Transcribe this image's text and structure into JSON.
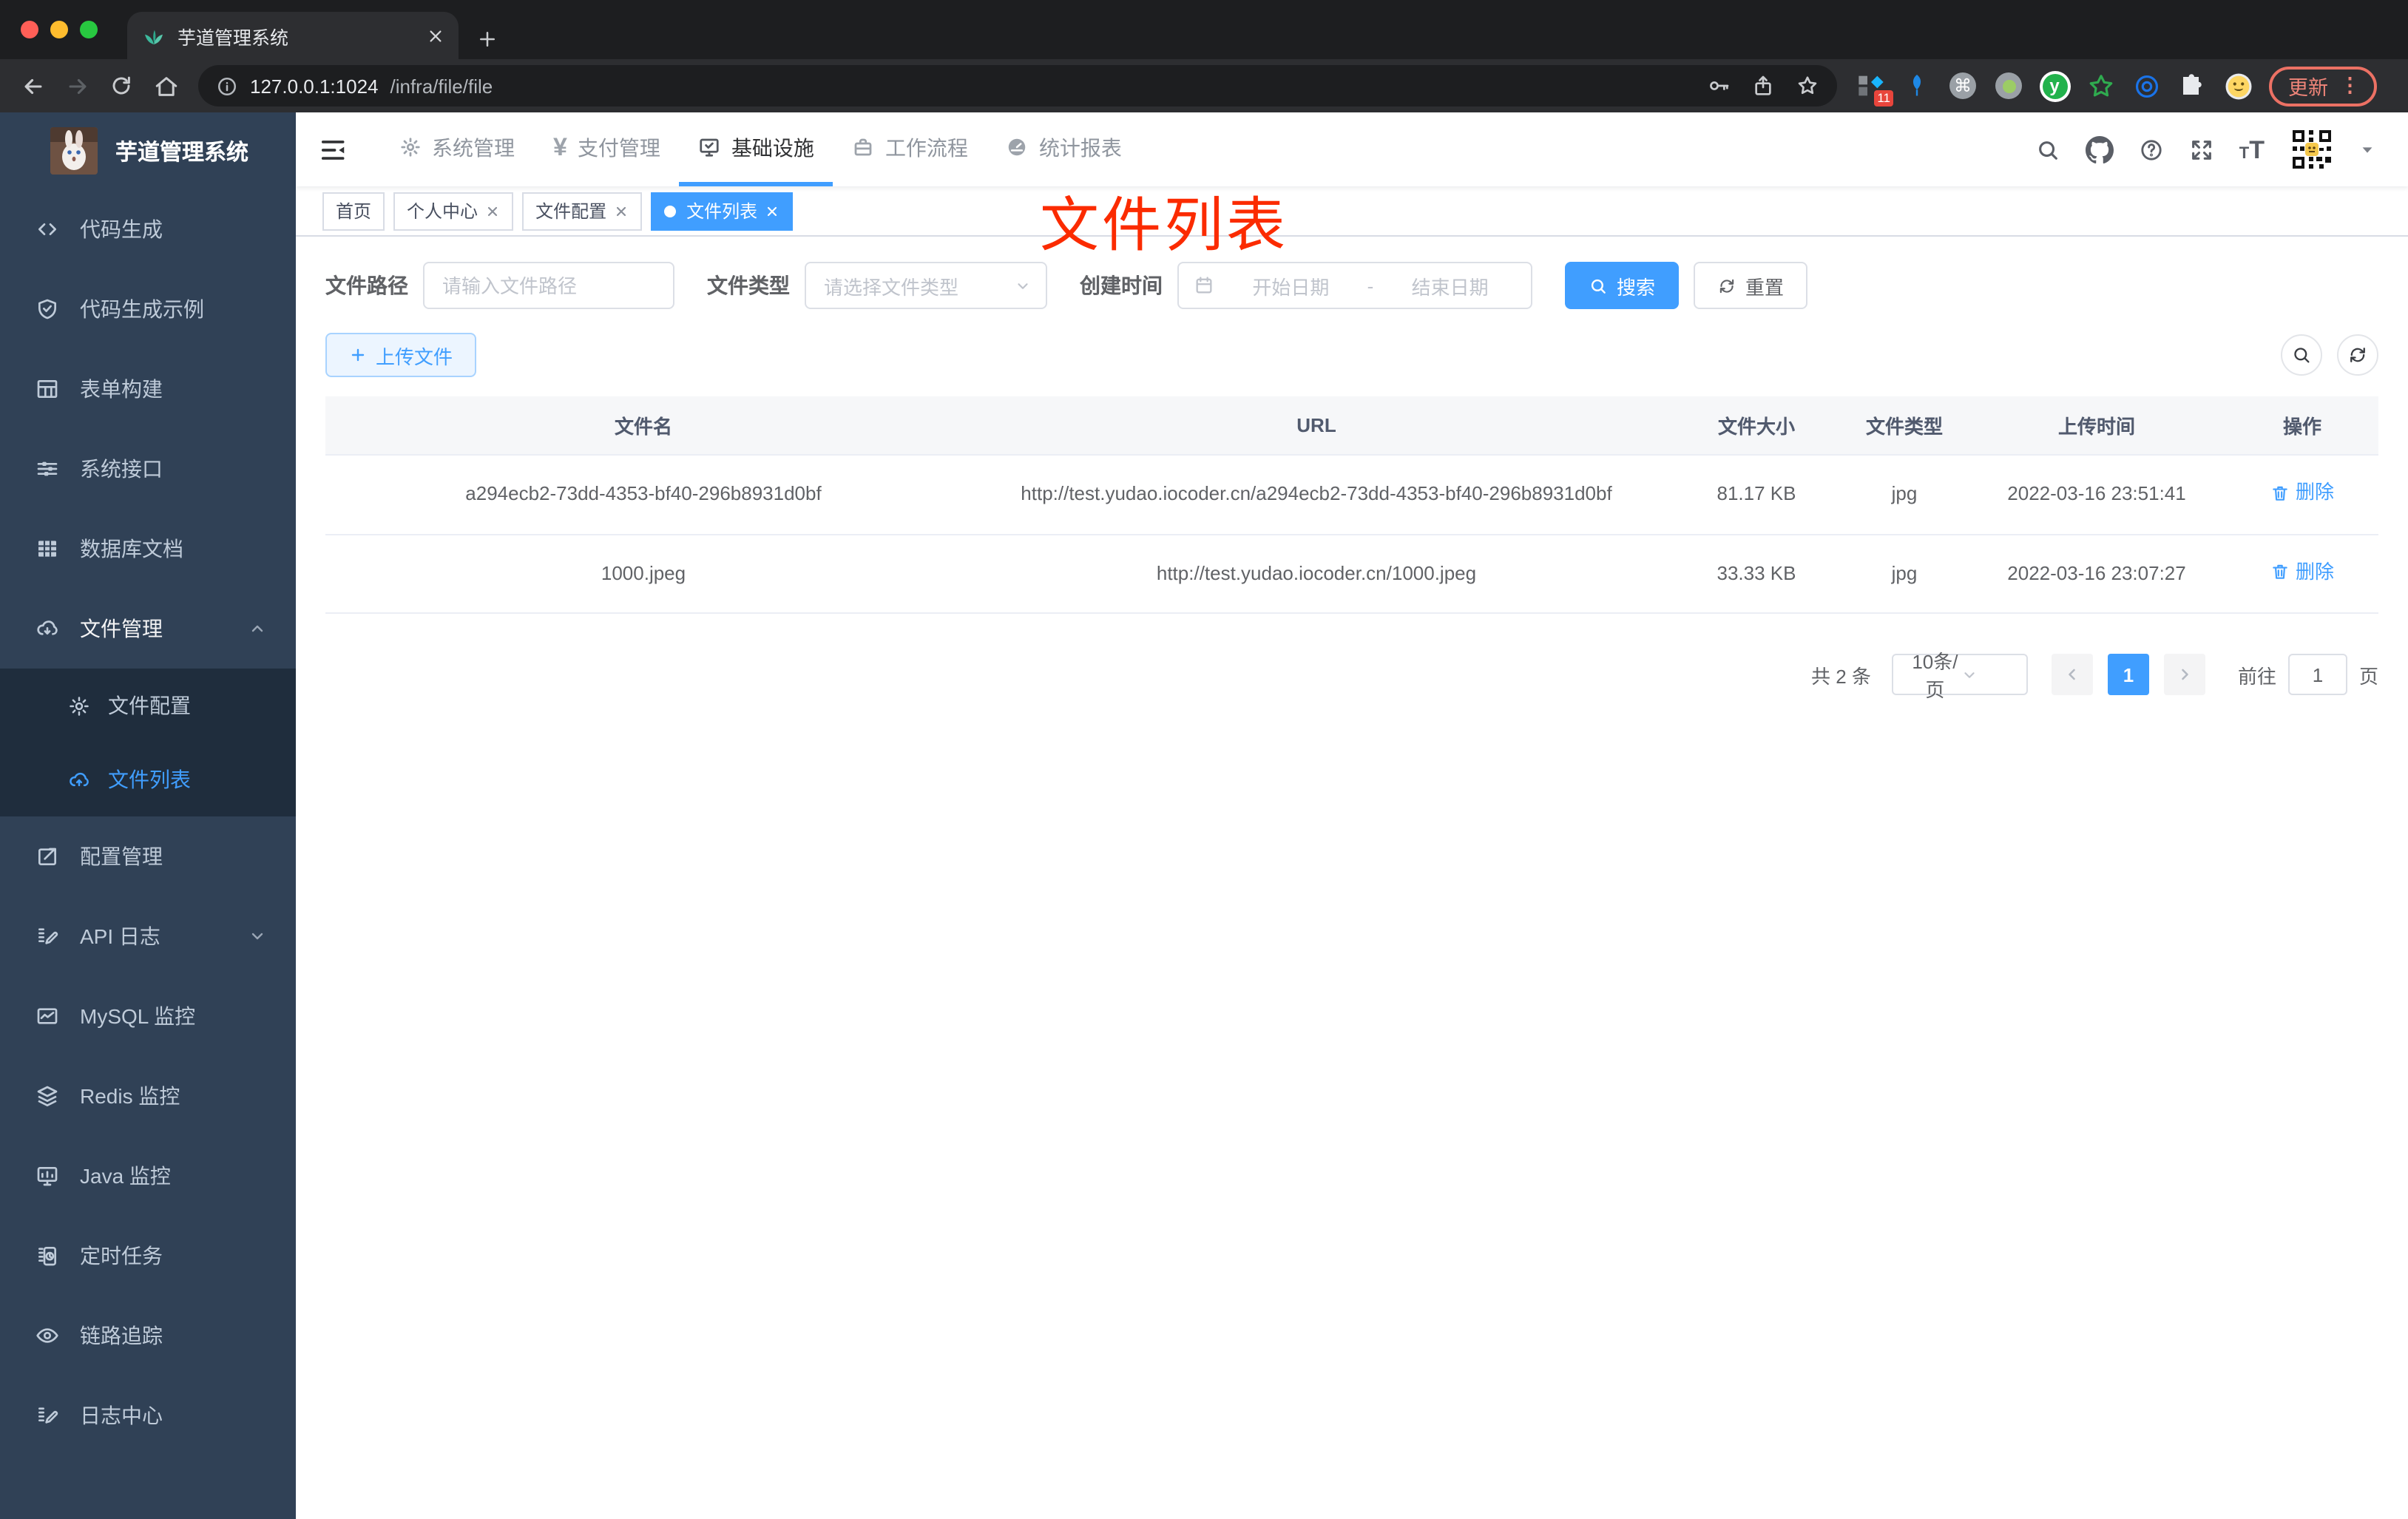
{
  "browser": {
    "tab_title": "芋道管理系统",
    "url_host": "127.0.0.1:1024",
    "url_path": "/infra/file/file",
    "update_label": "更新",
    "extension_badge": "11",
    "glyphs": {
      "cmd": "⌘",
      "ext_y": "y",
      "menu_dots": "⋮"
    }
  },
  "header": {
    "menus": [
      {
        "label": "系统管理"
      },
      {
        "label": "支付管理"
      },
      {
        "label": "基础设施"
      },
      {
        "label": "工作流程"
      },
      {
        "label": "统计报表"
      }
    ],
    "yen_glyph": "¥",
    "font_size_glyph_small": "T",
    "font_size_glyph_large": "T"
  },
  "sidebar": {
    "title": "芋道管理系统",
    "items": [
      {
        "label": "代码生成",
        "icon": "code-icon"
      },
      {
        "label": "代码生成示例",
        "icon": "shield-check-icon"
      },
      {
        "label": "表单构建",
        "icon": "form-grid-icon"
      },
      {
        "label": "系统接口",
        "icon": "sliders-icon"
      },
      {
        "label": "数据库文档",
        "icon": "database-table-icon"
      },
      {
        "label": "文件管理",
        "icon": "cloud-download-icon",
        "children": [
          {
            "label": "文件配置",
            "icon": "gear-icon"
          },
          {
            "label": "文件列表",
            "icon": "cloud-upload-icon"
          }
        ]
      },
      {
        "label": "配置管理",
        "icon": "edit-square-icon"
      },
      {
        "label": "API 日志",
        "icon": "log-doc-icon"
      },
      {
        "label": "MySQL 监控",
        "icon": "chart-monitor-icon"
      },
      {
        "label": "Redis 监控",
        "icon": "layers-icon"
      },
      {
        "label": "Java 监控",
        "icon": "monitor-icon"
      },
      {
        "label": "定时任务",
        "icon": "timer-doc-icon"
      },
      {
        "label": "链路追踪",
        "icon": "eye-icon"
      },
      {
        "label": "日志中心",
        "icon": "log-center-icon"
      }
    ]
  },
  "tags": [
    {
      "label": "首页"
    },
    {
      "label": "个人中心"
    },
    {
      "label": "文件配置"
    },
    {
      "label": "文件列表"
    }
  ],
  "annotation": {
    "text": "文件列表",
    "color": "#FB2B00"
  },
  "filters": {
    "path_label": "文件路径",
    "path_placeholder": "请输入文件路径",
    "type_label": "文件类型",
    "type_placeholder": "请选择文件类型",
    "date_label": "创建时间",
    "date_start_placeholder": "开始日期",
    "date_separator": "-",
    "date_end_placeholder": "结束日期",
    "search_label": "搜索",
    "reset_label": "重置"
  },
  "toolbar": {
    "upload_label": "上传文件"
  },
  "table": {
    "headers": [
      "文件名",
      "URL",
      "文件大小",
      "文件类型",
      "上传时间",
      "操作"
    ],
    "rows": [
      {
        "name": "a294ecb2-73dd-4353-bf40-296b8931d0bf",
        "url": "http://test.yudao.iocoder.cn/a294ecb2-73dd-4353-bf40-296b8931d0bf",
        "size": "81.17 KB",
        "type": "jpg",
        "time": "2022-03-16 23:51:41",
        "action": "删除"
      },
      {
        "name": "1000.jpeg",
        "url": "http://test.yudao.iocoder.cn/1000.jpeg",
        "size": "33.33 KB",
        "type": "jpg",
        "time": "2022-03-16 23:07:27",
        "action": "删除"
      }
    ]
  },
  "pagination": {
    "total": "共 2 条",
    "page_size": "10条/页",
    "current": "1",
    "goto_label": "前往",
    "goto_value": "1",
    "unit": "页"
  },
  "colors": {
    "accent": "#409EFF",
    "sidebar_bg": "#304156",
    "submenu_bg": "#1F2D3D",
    "annotation_red": "#FB2B00",
    "update_chip": "#F08579",
    "tag_active": "#409EFF"
  }
}
